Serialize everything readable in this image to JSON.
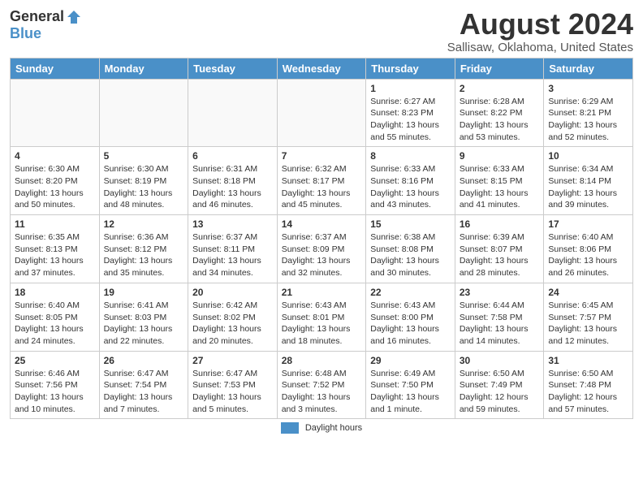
{
  "logo": {
    "general": "General",
    "blue": "Blue"
  },
  "title": "August 2024",
  "subtitle": "Sallisaw, Oklahoma, United States",
  "weekdays": [
    "Sunday",
    "Monday",
    "Tuesday",
    "Wednesday",
    "Thursday",
    "Friday",
    "Saturday"
  ],
  "weeks": [
    [
      {
        "day": "",
        "sunrise": "",
        "sunset": "",
        "daylight": ""
      },
      {
        "day": "",
        "sunrise": "",
        "sunset": "",
        "daylight": ""
      },
      {
        "day": "",
        "sunrise": "",
        "sunset": "",
        "daylight": ""
      },
      {
        "day": "",
        "sunrise": "",
        "sunset": "",
        "daylight": ""
      },
      {
        "day": "1",
        "sunrise": "Sunrise: 6:27 AM",
        "sunset": "Sunset: 8:23 PM",
        "daylight": "Daylight: 13 hours and 55 minutes."
      },
      {
        "day": "2",
        "sunrise": "Sunrise: 6:28 AM",
        "sunset": "Sunset: 8:22 PM",
        "daylight": "Daylight: 13 hours and 53 minutes."
      },
      {
        "day": "3",
        "sunrise": "Sunrise: 6:29 AM",
        "sunset": "Sunset: 8:21 PM",
        "daylight": "Daylight: 13 hours and 52 minutes."
      }
    ],
    [
      {
        "day": "4",
        "sunrise": "Sunrise: 6:30 AM",
        "sunset": "Sunset: 8:20 PM",
        "daylight": "Daylight: 13 hours and 50 minutes."
      },
      {
        "day": "5",
        "sunrise": "Sunrise: 6:30 AM",
        "sunset": "Sunset: 8:19 PM",
        "daylight": "Daylight: 13 hours and 48 minutes."
      },
      {
        "day": "6",
        "sunrise": "Sunrise: 6:31 AM",
        "sunset": "Sunset: 8:18 PM",
        "daylight": "Daylight: 13 hours and 46 minutes."
      },
      {
        "day": "7",
        "sunrise": "Sunrise: 6:32 AM",
        "sunset": "Sunset: 8:17 PM",
        "daylight": "Daylight: 13 hours and 45 minutes."
      },
      {
        "day": "8",
        "sunrise": "Sunrise: 6:33 AM",
        "sunset": "Sunset: 8:16 PM",
        "daylight": "Daylight: 13 hours and 43 minutes."
      },
      {
        "day": "9",
        "sunrise": "Sunrise: 6:33 AM",
        "sunset": "Sunset: 8:15 PM",
        "daylight": "Daylight: 13 hours and 41 minutes."
      },
      {
        "day": "10",
        "sunrise": "Sunrise: 6:34 AM",
        "sunset": "Sunset: 8:14 PM",
        "daylight": "Daylight: 13 hours and 39 minutes."
      }
    ],
    [
      {
        "day": "11",
        "sunrise": "Sunrise: 6:35 AM",
        "sunset": "Sunset: 8:13 PM",
        "daylight": "Daylight: 13 hours and 37 minutes."
      },
      {
        "day": "12",
        "sunrise": "Sunrise: 6:36 AM",
        "sunset": "Sunset: 8:12 PM",
        "daylight": "Daylight: 13 hours and 35 minutes."
      },
      {
        "day": "13",
        "sunrise": "Sunrise: 6:37 AM",
        "sunset": "Sunset: 8:11 PM",
        "daylight": "Daylight: 13 hours and 34 minutes."
      },
      {
        "day": "14",
        "sunrise": "Sunrise: 6:37 AM",
        "sunset": "Sunset: 8:09 PM",
        "daylight": "Daylight: 13 hours and 32 minutes."
      },
      {
        "day": "15",
        "sunrise": "Sunrise: 6:38 AM",
        "sunset": "Sunset: 8:08 PM",
        "daylight": "Daylight: 13 hours and 30 minutes."
      },
      {
        "day": "16",
        "sunrise": "Sunrise: 6:39 AM",
        "sunset": "Sunset: 8:07 PM",
        "daylight": "Daylight: 13 hours and 28 minutes."
      },
      {
        "day": "17",
        "sunrise": "Sunrise: 6:40 AM",
        "sunset": "Sunset: 8:06 PM",
        "daylight": "Daylight: 13 hours and 26 minutes."
      }
    ],
    [
      {
        "day": "18",
        "sunrise": "Sunrise: 6:40 AM",
        "sunset": "Sunset: 8:05 PM",
        "daylight": "Daylight: 13 hours and 24 minutes."
      },
      {
        "day": "19",
        "sunrise": "Sunrise: 6:41 AM",
        "sunset": "Sunset: 8:03 PM",
        "daylight": "Daylight: 13 hours and 22 minutes."
      },
      {
        "day": "20",
        "sunrise": "Sunrise: 6:42 AM",
        "sunset": "Sunset: 8:02 PM",
        "daylight": "Daylight: 13 hours and 20 minutes."
      },
      {
        "day": "21",
        "sunrise": "Sunrise: 6:43 AM",
        "sunset": "Sunset: 8:01 PM",
        "daylight": "Daylight: 13 hours and 18 minutes."
      },
      {
        "day": "22",
        "sunrise": "Sunrise: 6:43 AM",
        "sunset": "Sunset: 8:00 PM",
        "daylight": "Daylight: 13 hours and 16 minutes."
      },
      {
        "day": "23",
        "sunrise": "Sunrise: 6:44 AM",
        "sunset": "Sunset: 7:58 PM",
        "daylight": "Daylight: 13 hours and 14 minutes."
      },
      {
        "day": "24",
        "sunrise": "Sunrise: 6:45 AM",
        "sunset": "Sunset: 7:57 PM",
        "daylight": "Daylight: 13 hours and 12 minutes."
      }
    ],
    [
      {
        "day": "25",
        "sunrise": "Sunrise: 6:46 AM",
        "sunset": "Sunset: 7:56 PM",
        "daylight": "Daylight: 13 hours and 10 minutes."
      },
      {
        "day": "26",
        "sunrise": "Sunrise: 6:47 AM",
        "sunset": "Sunset: 7:54 PM",
        "daylight": "Daylight: 13 hours and 7 minutes."
      },
      {
        "day": "27",
        "sunrise": "Sunrise: 6:47 AM",
        "sunset": "Sunset: 7:53 PM",
        "daylight": "Daylight: 13 hours and 5 minutes."
      },
      {
        "day": "28",
        "sunrise": "Sunrise: 6:48 AM",
        "sunset": "Sunset: 7:52 PM",
        "daylight": "Daylight: 13 hours and 3 minutes."
      },
      {
        "day": "29",
        "sunrise": "Sunrise: 6:49 AM",
        "sunset": "Sunset: 7:50 PM",
        "daylight": "Daylight: 13 hours and 1 minute."
      },
      {
        "day": "30",
        "sunrise": "Sunrise: 6:50 AM",
        "sunset": "Sunset: 7:49 PM",
        "daylight": "Daylight: 12 hours and 59 minutes."
      },
      {
        "day": "31",
        "sunrise": "Sunrise: 6:50 AM",
        "sunset": "Sunset: 7:48 PM",
        "daylight": "Daylight: 12 hours and 57 minutes."
      }
    ]
  ],
  "legend": {
    "label": "Daylight hours"
  }
}
